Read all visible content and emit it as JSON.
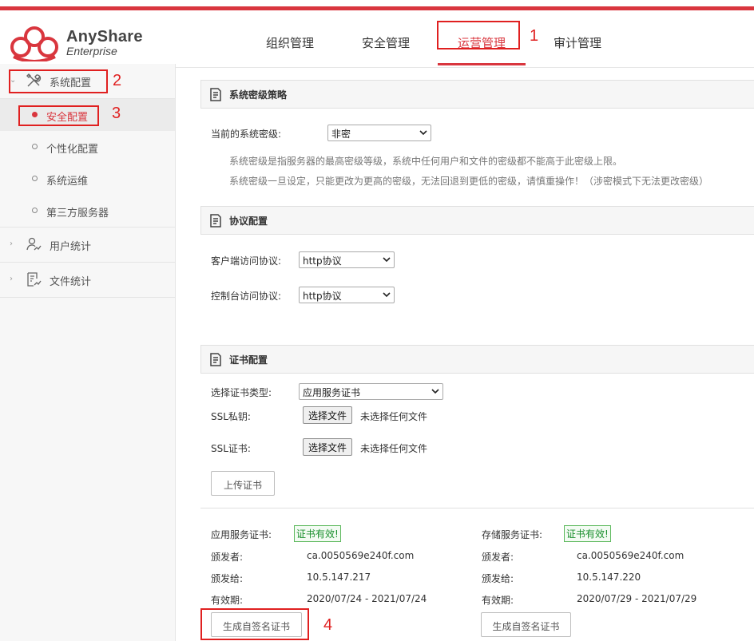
{
  "brand": {
    "name": "AnyShare",
    "sub": "Enterprise"
  },
  "nav": {
    "tabs": [
      "组织管理",
      "安全管理",
      "运营管理",
      "审计管理"
    ],
    "active": "运营管理"
  },
  "sidebar": {
    "groups": [
      {
        "label": "系统配置",
        "icon": "tools-icon",
        "expanded": true
      },
      {
        "label": "用户统计",
        "icon": "user-chart-icon",
        "expanded": false
      },
      {
        "label": "文件统计",
        "icon": "file-chart-icon",
        "expanded": false
      }
    ],
    "items": [
      "安全配置",
      "个性化配置",
      "系统运维",
      "第三方服务器"
    ],
    "active_item": "安全配置"
  },
  "security_level": {
    "title": "系统密级策略",
    "label": "当前的系统密级:",
    "value": "非密",
    "desc1": "系统密级是指服务器的最高密级等级，系统中任何用户和文件的密级都不能高于此密级上限。",
    "desc2": "系统密级一旦设定，只能更改为更高的密级，无法回退到更低的密级，请慎重操作！（涉密模式下无法更改密级）"
  },
  "protocol": {
    "title": "协议配置",
    "client_label": "客户端访问协议:",
    "client_value": "http协议",
    "console_label": "控制台访问协议:",
    "console_value": "http协议"
  },
  "certificate": {
    "title": "证书配置",
    "type_label": "选择证书类型:",
    "type_value": "应用服务证书",
    "key_label": "SSL私钥:",
    "cert_label": "SSL证书:",
    "choose_file": "选择文件",
    "no_file": "未选择任何文件",
    "upload_button": "上传证书",
    "app_cert": {
      "label": "应用服务证书:",
      "status": "证书有效!",
      "issuer_label": "颁发者:",
      "issuer": "ca.0050569e240f.com",
      "issued_to_label": "颁发给:",
      "issued_to": "10.5.147.217",
      "validity_label": "有效期:",
      "validity": "2020/07/24 - 2021/07/24",
      "button": "生成自签名证书"
    },
    "storage_cert": {
      "label": "存储服务证书:",
      "status": "证书有效!",
      "issuer_label": "颁发者:",
      "issuer": "ca.0050569e240f.com",
      "issued_to_label": "颁发给:",
      "issued_to": "10.5.147.220",
      "validity_label": "有效期:",
      "validity": "2020/07/29 - 2021/07/29",
      "button": "生成自签名证书"
    }
  },
  "annotations": [
    "1",
    "2",
    "3",
    "4"
  ],
  "colors": {
    "accent": "#d9363e",
    "annotation": "#e02020",
    "valid": "#1a8f2d"
  }
}
